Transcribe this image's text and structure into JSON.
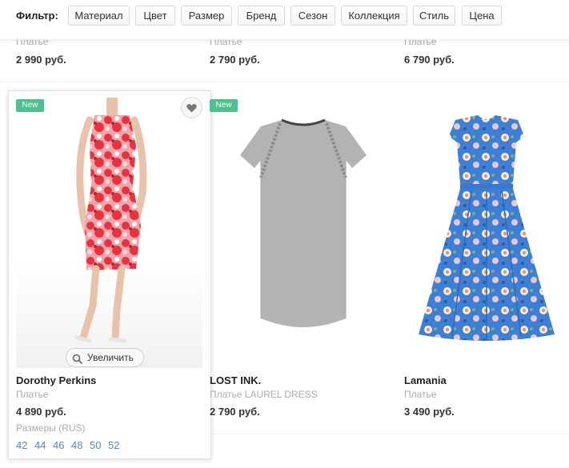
{
  "filter": {
    "label": "Фильтр:",
    "buttons": [
      "Материал",
      "Цвет",
      "Размер",
      "Бренд",
      "Сезон",
      "Коллекция",
      "Стиль",
      "Цена"
    ]
  },
  "previous_row": [
    {
      "category": "Платье",
      "price": "2 990 руб."
    },
    {
      "category": "Платье",
      "price": "2 790 руб."
    },
    {
      "category": "Платье",
      "price": "6 790 руб."
    }
  ],
  "products": [
    {
      "badge": "New",
      "brand": "Dorothy Perkins",
      "category": "Платье",
      "price": "4 890 руб.",
      "zoom_label": "Увеличить"
    },
    {
      "badge": "New",
      "brand": "LOST INK.",
      "category": "Платье LAUREL DRESS",
      "price": "2 790 руб."
    },
    {
      "brand": "Lamania",
      "category": "Платье",
      "price": "3 490 руб."
    }
  ],
  "sizes": {
    "label": "Размеры (RUS)",
    "values": [
      "42",
      "44",
      "46",
      "48",
      "50",
      "52"
    ]
  },
  "colors": {
    "badge_green": "#4fc08d",
    "size_link": "#5b86b5"
  }
}
